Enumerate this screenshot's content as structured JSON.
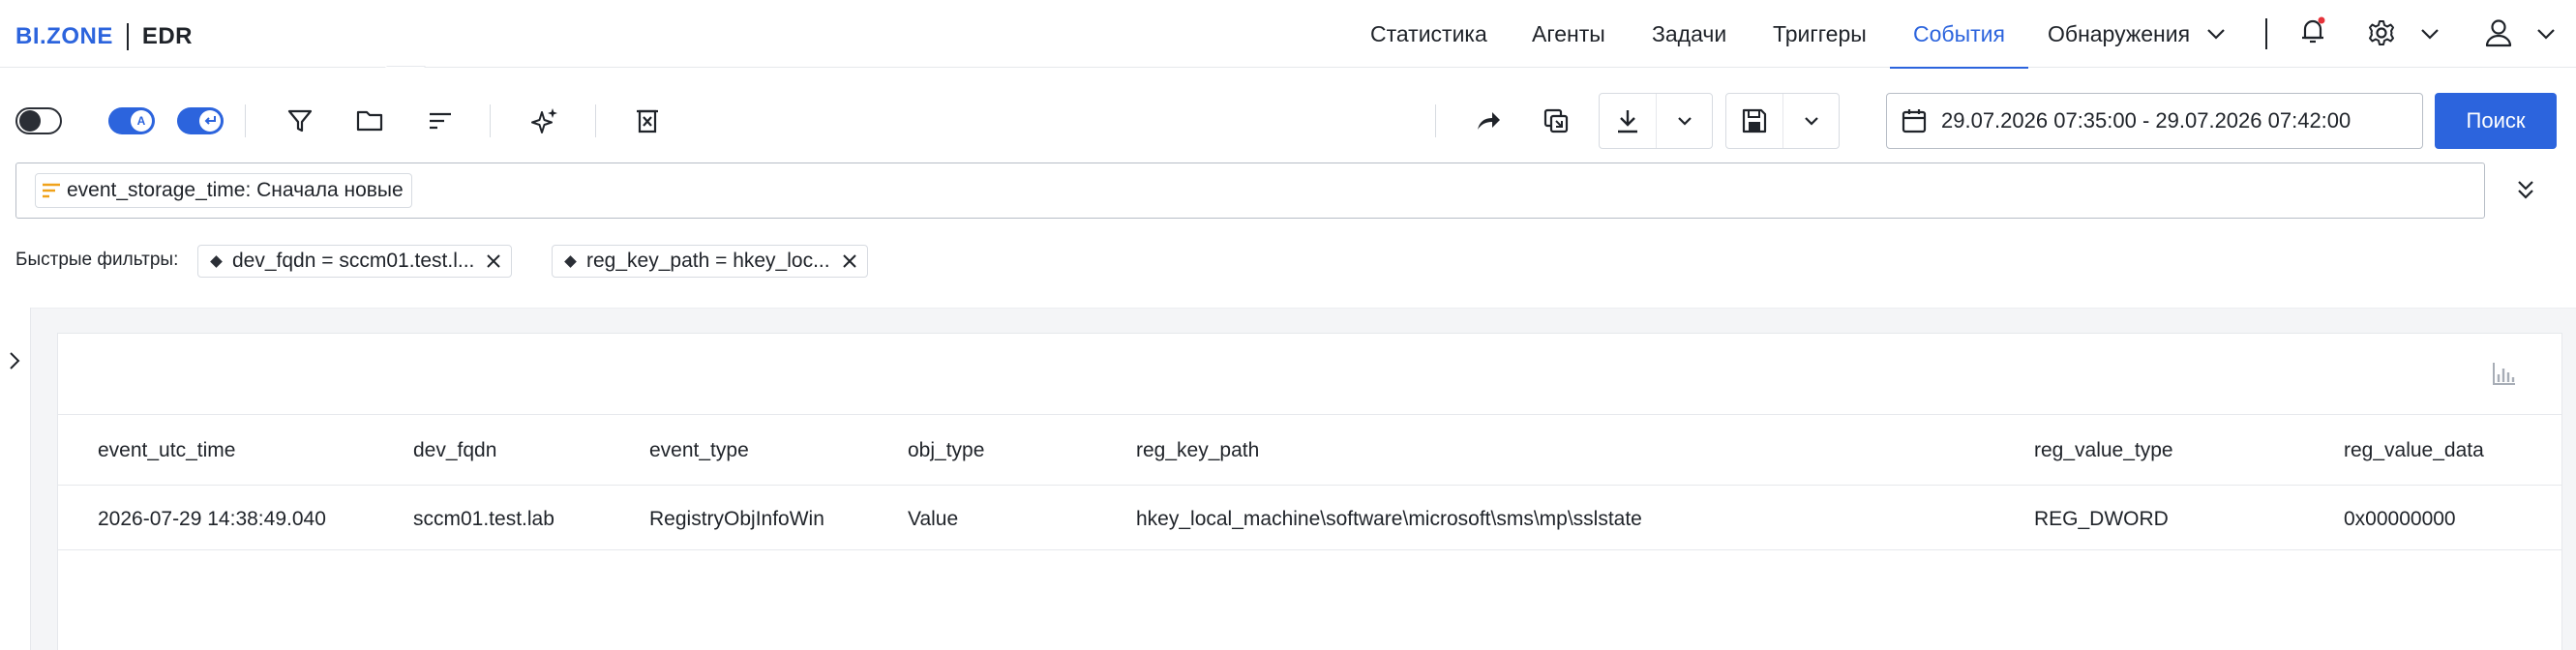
{
  "app": {
    "logo_brand": "BI.ZONE",
    "logo_product": "EDR"
  },
  "nav": {
    "items": [
      {
        "label": "Статистика"
      },
      {
        "label": "Агенты"
      },
      {
        "label": "Задачи"
      },
      {
        "label": "Триггеры"
      },
      {
        "label": "События",
        "active": true
      },
      {
        "label": "Обнаружения"
      }
    ],
    "icons": [
      "chevron-down-icon",
      "bell-icon",
      "gear-icon",
      "user-icon"
    ],
    "notification_dot_color": "#e5333a"
  },
  "toolbar": {
    "date_range": "29.07.2026 07:35:00 - 29.07.2026 07:42:00",
    "search_label": "Поиск",
    "toggle_a_letter": "A",
    "accent_color": "#2c64dd"
  },
  "query": {
    "sort_chip": "event_storage_time: Сначала новые"
  },
  "quick_filters": {
    "label": "Быстрые фильтры:",
    "chips": [
      {
        "text": "dev_fqdn = sccm01.test.l..."
      },
      {
        "text": "reg_key_path = hkey_loc..."
      }
    ]
  },
  "table": {
    "columns": [
      "event_utc_time",
      "dev_fqdn",
      "event_type",
      "obj_type",
      "reg_key_path",
      "reg_value_type",
      "reg_value_data"
    ],
    "rows": [
      [
        "2026-07-29 14:38:49.040",
        "sccm01.test.lab",
        "RegistryObjInfoWin",
        "Value",
        "hkey_local_machine\\software\\microsoft\\sms\\mp\\sslstate",
        "REG_DWORD",
        "0x00000000"
      ]
    ]
  }
}
